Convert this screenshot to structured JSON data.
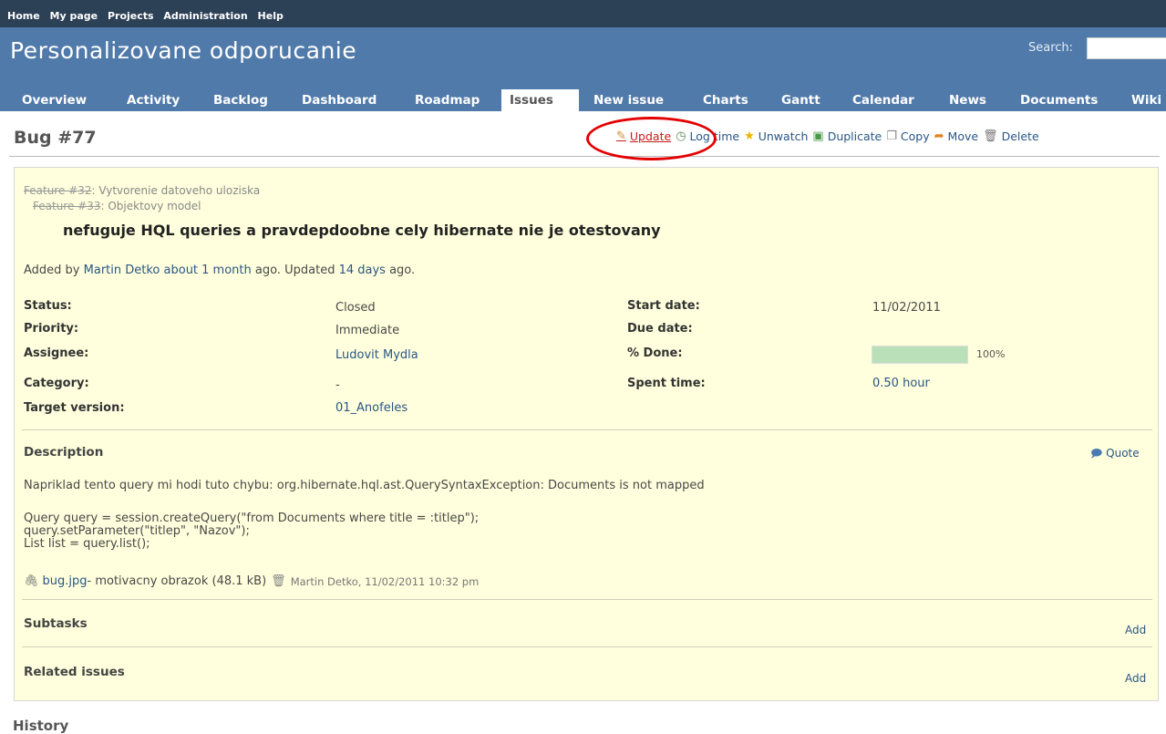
{
  "top_menu": {
    "items": [
      "Home",
      "My page",
      "Projects",
      "Administration",
      "Help"
    ]
  },
  "header": {
    "project_title": "Personalizovane odporucanie",
    "search_label": "Search:",
    "search_value": ""
  },
  "tabs": [
    "Overview",
    "Activity",
    "Backlog",
    "Dashboard",
    "Roadmap",
    "Issues",
    "New issue",
    "Charts",
    "Gantt",
    "Calendar",
    "News",
    "Documents",
    "Wiki"
  ],
  "selected_tab": "Issues",
  "issue": {
    "title": "Bug #77",
    "contextual": {
      "update": "Update",
      "log_time": "Log time",
      "unwatch": "Unwatch",
      "duplicate": "Duplicate",
      "copy": "Copy",
      "move": "Move",
      "delete": "Delete"
    },
    "parents": [
      {
        "link": "Feature #32",
        "text": ": Vytvorenie datoveho uloziska"
      },
      {
        "link": "Feature #33",
        "text": ": Objektovy model"
      }
    ],
    "subject": "nefuguje HQL queries a pravdepdoobne cely hibernate nie je otestovany",
    "author_line": {
      "added_by": "Added by",
      "author": "Martin Detko",
      "added_ago": "about 1 month",
      "ago_updated": "ago. Updated",
      "updated_ago": "14 days",
      "ago": "ago."
    },
    "attributes": {
      "status_label": "Status:",
      "status": "Closed",
      "priority_label": "Priority:",
      "priority": "Immediate",
      "assignee_label": "Assignee:",
      "assignee": "Ludovit Mydla",
      "category_label": "Category:",
      "category": "-",
      "target_version_label": "Target version:",
      "target_version": "01_Anofeles",
      "start_date_label": "Start date:",
      "start_date": "11/02/2011",
      "due_date_label": "Due date:",
      "due_date": "",
      "done_label": "% Done:",
      "done_value": 100,
      "done_text": "100%",
      "spent_time_label": "Spent time:",
      "spent_time": "0.50 hour"
    },
    "description": {
      "title": "Description",
      "quote": "Quote",
      "text": "Napriklad tento query mi hodi tuto chybu: org.hibernate.hql.ast.QuerySyntaxException: Documents is not mapped",
      "code": "Query query = session.createQuery(\"from Documents where title = :titlep\");\nquery.setParameter(\"titlep\", \"Nazov\");\nList list = query.list();"
    },
    "attachment": {
      "filename": "bug.jpg",
      "desc": " - motivacny obrazok (48.1 kB)",
      "meta": "Martin Detko, 11/02/2011 10:32 pm"
    },
    "subtasks": {
      "title": "Subtasks",
      "add": "Add"
    },
    "related": {
      "title": "Related issues",
      "add": "Add"
    }
  },
  "history_title": "History",
  "colors": {
    "header": "#507aaa",
    "top_menu": "#2c4056",
    "issue_bg": "#ffffdd",
    "link": "#2a5685",
    "highlight_ellipse": "#e40000"
  }
}
